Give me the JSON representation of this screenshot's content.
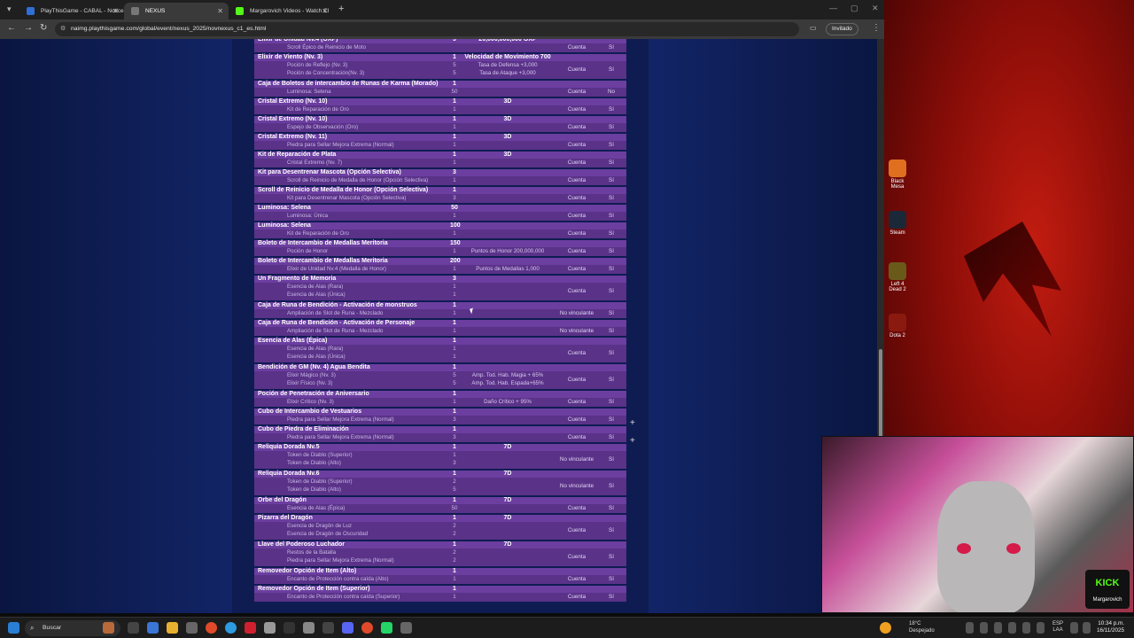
{
  "browser": {
    "tabs": [
      {
        "label": "PlayThisGame - CABAL - Notice",
        "color": "#2f6fd6"
      },
      {
        "label": "NEXUS",
        "color": "#777777",
        "active": true
      },
      {
        "label": "Margarovich Videos - Watch Cl",
        "color": "#53fc18"
      }
    ],
    "url": "naimg.playthisgame.com/global/event/nexus_2025/novnexus_c1_es.html",
    "incognito_label": "Invitado"
  },
  "rows": [
    {
      "name": "Elixir de Unidad Nv.4 (OXP)",
      "qty": "5",
      "value": "20,000,000,000 OXP",
      "lines": [
        {
          "n": "Scroll Épico de Reinicio de Moto",
          "q": "",
          "v": ""
        }
      ],
      "type": "Cuenta",
      "trade": "Sí"
    },
    {
      "name": "Elixir de Viento (Nv. 3)",
      "qty": "1",
      "value": "Velocidad de Movimiento 700",
      "lines": [
        {
          "n": "Poción de Reflejo (Nv. 3)",
          "q": "5",
          "v": "Tasa de Defensa +3,000"
        },
        {
          "n": "Poción de Concentración(Nv. 3)",
          "q": "5",
          "v": "Tasa de Ataque +3,000"
        }
      ],
      "type": "Cuenta",
      "trade": "Sí"
    },
    {
      "name": "Caja de Boletos de intercambio de Runas de Karma (Morado)",
      "qty": "1",
      "value": "",
      "lines": [
        {
          "n": "Luminosa: Selena",
          "q": "50",
          "v": ""
        }
      ],
      "type": "Cuenta",
      "trade": "No"
    },
    {
      "name": "Cristal Extremo (Nv. 10)",
      "qty": "1",
      "value": "3D",
      "lines": [
        {
          "n": "Kit de Reparación de Oro",
          "q": "1",
          "v": ""
        }
      ],
      "type": "Cuenta",
      "trade": "Sí"
    },
    {
      "name": "Cristal Extremo (Nv. 10)",
      "qty": "1",
      "value": "3D",
      "lines": [
        {
          "n": "Espejo de Observación (Oro)",
          "q": "1",
          "v": ""
        }
      ],
      "type": "Cuenta",
      "trade": "Sí"
    },
    {
      "name": "Cristal Extremo (Nv. 11)",
      "qty": "1",
      "value": "3D",
      "lines": [
        {
          "n": "Piedra para Sellar Mejora Extrema (Normal)",
          "q": "1",
          "v": ""
        }
      ],
      "type": "Cuenta",
      "trade": "Sí"
    },
    {
      "name": "Kit de Reparación de Plata",
      "qty": "1",
      "value": "3D",
      "lines": [
        {
          "n": "Cristal Extremo (Nv. 7)",
          "q": "1",
          "v": ""
        }
      ],
      "type": "Cuenta",
      "trade": "Sí"
    },
    {
      "name": "Kit para Desentrenar Mascota (Opción Selectiva)",
      "qty": "3",
      "value": "",
      "lines": [
        {
          "n": "Scroll de Reinicio de Medalla de Honor (Opción Selectiva)",
          "q": "1",
          "v": ""
        }
      ],
      "type": "Cuenta",
      "trade": "Sí"
    },
    {
      "name": "Scroll de Reinicio de Medalla de Honor (Opción Selectiva)",
      "qty": "1",
      "value": "",
      "lines": [
        {
          "n": "Kit para Desentrenar Mascota (Opción Selectiva)",
          "q": "3",
          "v": ""
        }
      ],
      "type": "Cuenta",
      "trade": "Sí"
    },
    {
      "name": "Luminosa: Selena",
      "qty": "50",
      "value": "",
      "lines": [
        {
          "n": "Luminosa: Única",
          "q": "1",
          "v": ""
        }
      ],
      "type": "Cuenta",
      "trade": "Sí"
    },
    {
      "name": "Luminosa: Selena",
      "qty": "100",
      "value": "",
      "lines": [
        {
          "n": "Kit de Reparación de Oro",
          "q": "1",
          "v": ""
        }
      ],
      "type": "Cuenta",
      "trade": "Sí"
    },
    {
      "name": "Boleto de Intercambio de Medallas Meritoria",
      "qty": "150",
      "value": "",
      "lines": [
        {
          "n": "Poción de Honor",
          "q": "1",
          "v": "Puntos de Honor 200,000,000"
        }
      ],
      "type": "Cuenta",
      "trade": "Sí"
    },
    {
      "name": "Boleto de Intercambio de Medallas Meritoria",
      "qty": "200",
      "value": "",
      "lines": [
        {
          "n": "Elixir de Unidad Nv.4 (Medalla de Honor)",
          "q": "1",
          "v": "Puntos de Medallas 1,000"
        }
      ],
      "type": "Cuenta",
      "trade": "Sí"
    },
    {
      "name": "Un Fragmento de Memoria",
      "qty": "3",
      "value": "",
      "lines": [
        {
          "n": "Esencia de Alas (Rara)",
          "q": "1",
          "v": ""
        },
        {
          "n": "Esencia de Alas (Única)",
          "q": "1",
          "v": ""
        }
      ],
      "type": "Cuenta",
      "trade": "Sí"
    },
    {
      "name": "Caja de Runa de Bendición - Activación de monstruos",
      "qty": "1",
      "value": "",
      "lines": [
        {
          "n": "Ampliación de Slot de Runa - Mezclado",
          "q": "1",
          "v": ""
        }
      ],
      "type": "No vinculante",
      "trade": "Sí"
    },
    {
      "name": "Caja de Runa de Bendición - Activación de Personaje",
      "qty": "1",
      "value": "",
      "lines": [
        {
          "n": "Ampliación de Slot de Runa - Mezclado",
          "q": "1",
          "v": ""
        }
      ],
      "type": "No vinculante",
      "trade": "Sí"
    },
    {
      "name": "Esencia de Alas (Épica)",
      "qty": "1",
      "value": "",
      "lines": [
        {
          "n": "Esencia de Alas (Rara)",
          "q": "1",
          "v": ""
        },
        {
          "n": "Esencia de Alas (Única)",
          "q": "1",
          "v": ""
        }
      ],
      "type": "Cuenta",
      "trade": "Sí"
    },
    {
      "name": "Bendición de GM (Nv. 4) Agua Bendita",
      "qty": "1",
      "value": "",
      "lines": [
        {
          "n": "Elixir Mágico (Nv. 3)",
          "q": "5",
          "v": "Amp. Tod. Hab. Magia + 65%"
        },
        {
          "n": "Elixir Físico (Nv. 3)",
          "q": "5",
          "v": "Amp. Tod. Hab. Espada+65%"
        }
      ],
      "type": "Cuenta",
      "trade": "Sí"
    },
    {
      "name": "Poción de Penetración de Aniversario",
      "qty": "1",
      "value": "",
      "lines": [
        {
          "n": "Elixir Crítico (Nv. 3)",
          "q": "1",
          "v": "Daño Crítico + 95%"
        }
      ],
      "type": "Cuenta",
      "trade": "Sí"
    },
    {
      "name": "Cubo de Intercambio de Vestuarios",
      "qty": "1",
      "value": "",
      "lines": [
        {
          "n": "Piedra para Sellar Mejora Extrema (Normal)",
          "q": "3",
          "v": ""
        }
      ],
      "type": "Cuenta",
      "trade": "Sí"
    },
    {
      "name": "Cubo de Piedra de Eliminación",
      "qty": "1",
      "value": "",
      "lines": [
        {
          "n": "Piedra para Sellar Mejora Extrema (Normal)",
          "q": "3",
          "v": ""
        }
      ],
      "type": "Cuenta",
      "trade": "Sí"
    },
    {
      "name": "Reliquia Dorada Nv.5",
      "qty": "1",
      "value": "7D",
      "lines": [
        {
          "n": "Token de Diablo (Superior)",
          "q": "1",
          "v": ""
        },
        {
          "n": "Token de Diablo (Alto)",
          "q": "3",
          "v": ""
        }
      ],
      "type": "No vinculante",
      "trade": "Sí"
    },
    {
      "name": "Reliquia Dorada Nv.6",
      "qty": "1",
      "value": "7D",
      "lines": [
        {
          "n": "Token de Diablo (Superior)",
          "q": "2",
          "v": ""
        },
        {
          "n": "Token de Diablo (Alto)",
          "q": "5",
          "v": ""
        }
      ],
      "type": "No vinculante",
      "trade": "Sí"
    },
    {
      "name": "Orbe del Dragón",
      "qty": "1",
      "value": "7D",
      "lines": [
        {
          "n": "Esencia de Alas (Épica)",
          "q": "50",
          "v": ""
        }
      ],
      "type": "Cuenta",
      "trade": "Sí"
    },
    {
      "name": "Pizarra del Dragón",
      "qty": "1",
      "value": "7D",
      "lines": [
        {
          "n": "Esencia de Dragón de Luz",
          "q": "2",
          "v": ""
        },
        {
          "n": "Esencia de Dragón de Oscuridad",
          "q": "2",
          "v": ""
        }
      ],
      "type": "Cuenta",
      "trade": "Sí"
    },
    {
      "name": "Llave del Poderoso Luchador",
      "qty": "1",
      "value": "7D",
      "lines": [
        {
          "n": "Restos de la Batalla",
          "q": "2",
          "v": ""
        },
        {
          "n": "Piedra para Sellar Mejora Extrema (Normal)",
          "q": "2",
          "v": ""
        }
      ],
      "type": "Cuenta",
      "trade": "Sí"
    },
    {
      "name": "Removedor Opción de Item (Alto)",
      "qty": "1",
      "value": "",
      "lines": [
        {
          "n": "Encanto de Protección contra caída (Alto)",
          "q": "1",
          "v": ""
        }
      ],
      "type": "Cuenta",
      "trade": "Sí"
    },
    {
      "name": "Removedor Opción de Item (Superior)",
      "qty": "1",
      "value": "",
      "lines": [
        {
          "n": "Encanto de Protección contra caída (Superior)",
          "q": "1",
          "v": ""
        }
      ],
      "type": "Cuenta",
      "trade": "Sí"
    }
  ],
  "desktop_icons": [
    {
      "label": "Black Mesa",
      "color": "#e07020"
    },
    {
      "label": "Steam",
      "color": "#1b2838"
    },
    {
      "label": "Left 4 Dead 2",
      "color": "#6a5a1a"
    },
    {
      "label": "Dota 2",
      "color": "#8a1a10"
    }
  ],
  "webcam": {
    "brand": "KICK",
    "channel": "Margarovich"
  },
  "taskbar": {
    "search_placeholder": "Buscar",
    "weather_temp": "18°C",
    "weather_desc": "Despejado",
    "lang_top": "ESP",
    "lang_bottom": "LAA",
    "time": "10:34 p.m.",
    "date": "16/11/2025"
  }
}
